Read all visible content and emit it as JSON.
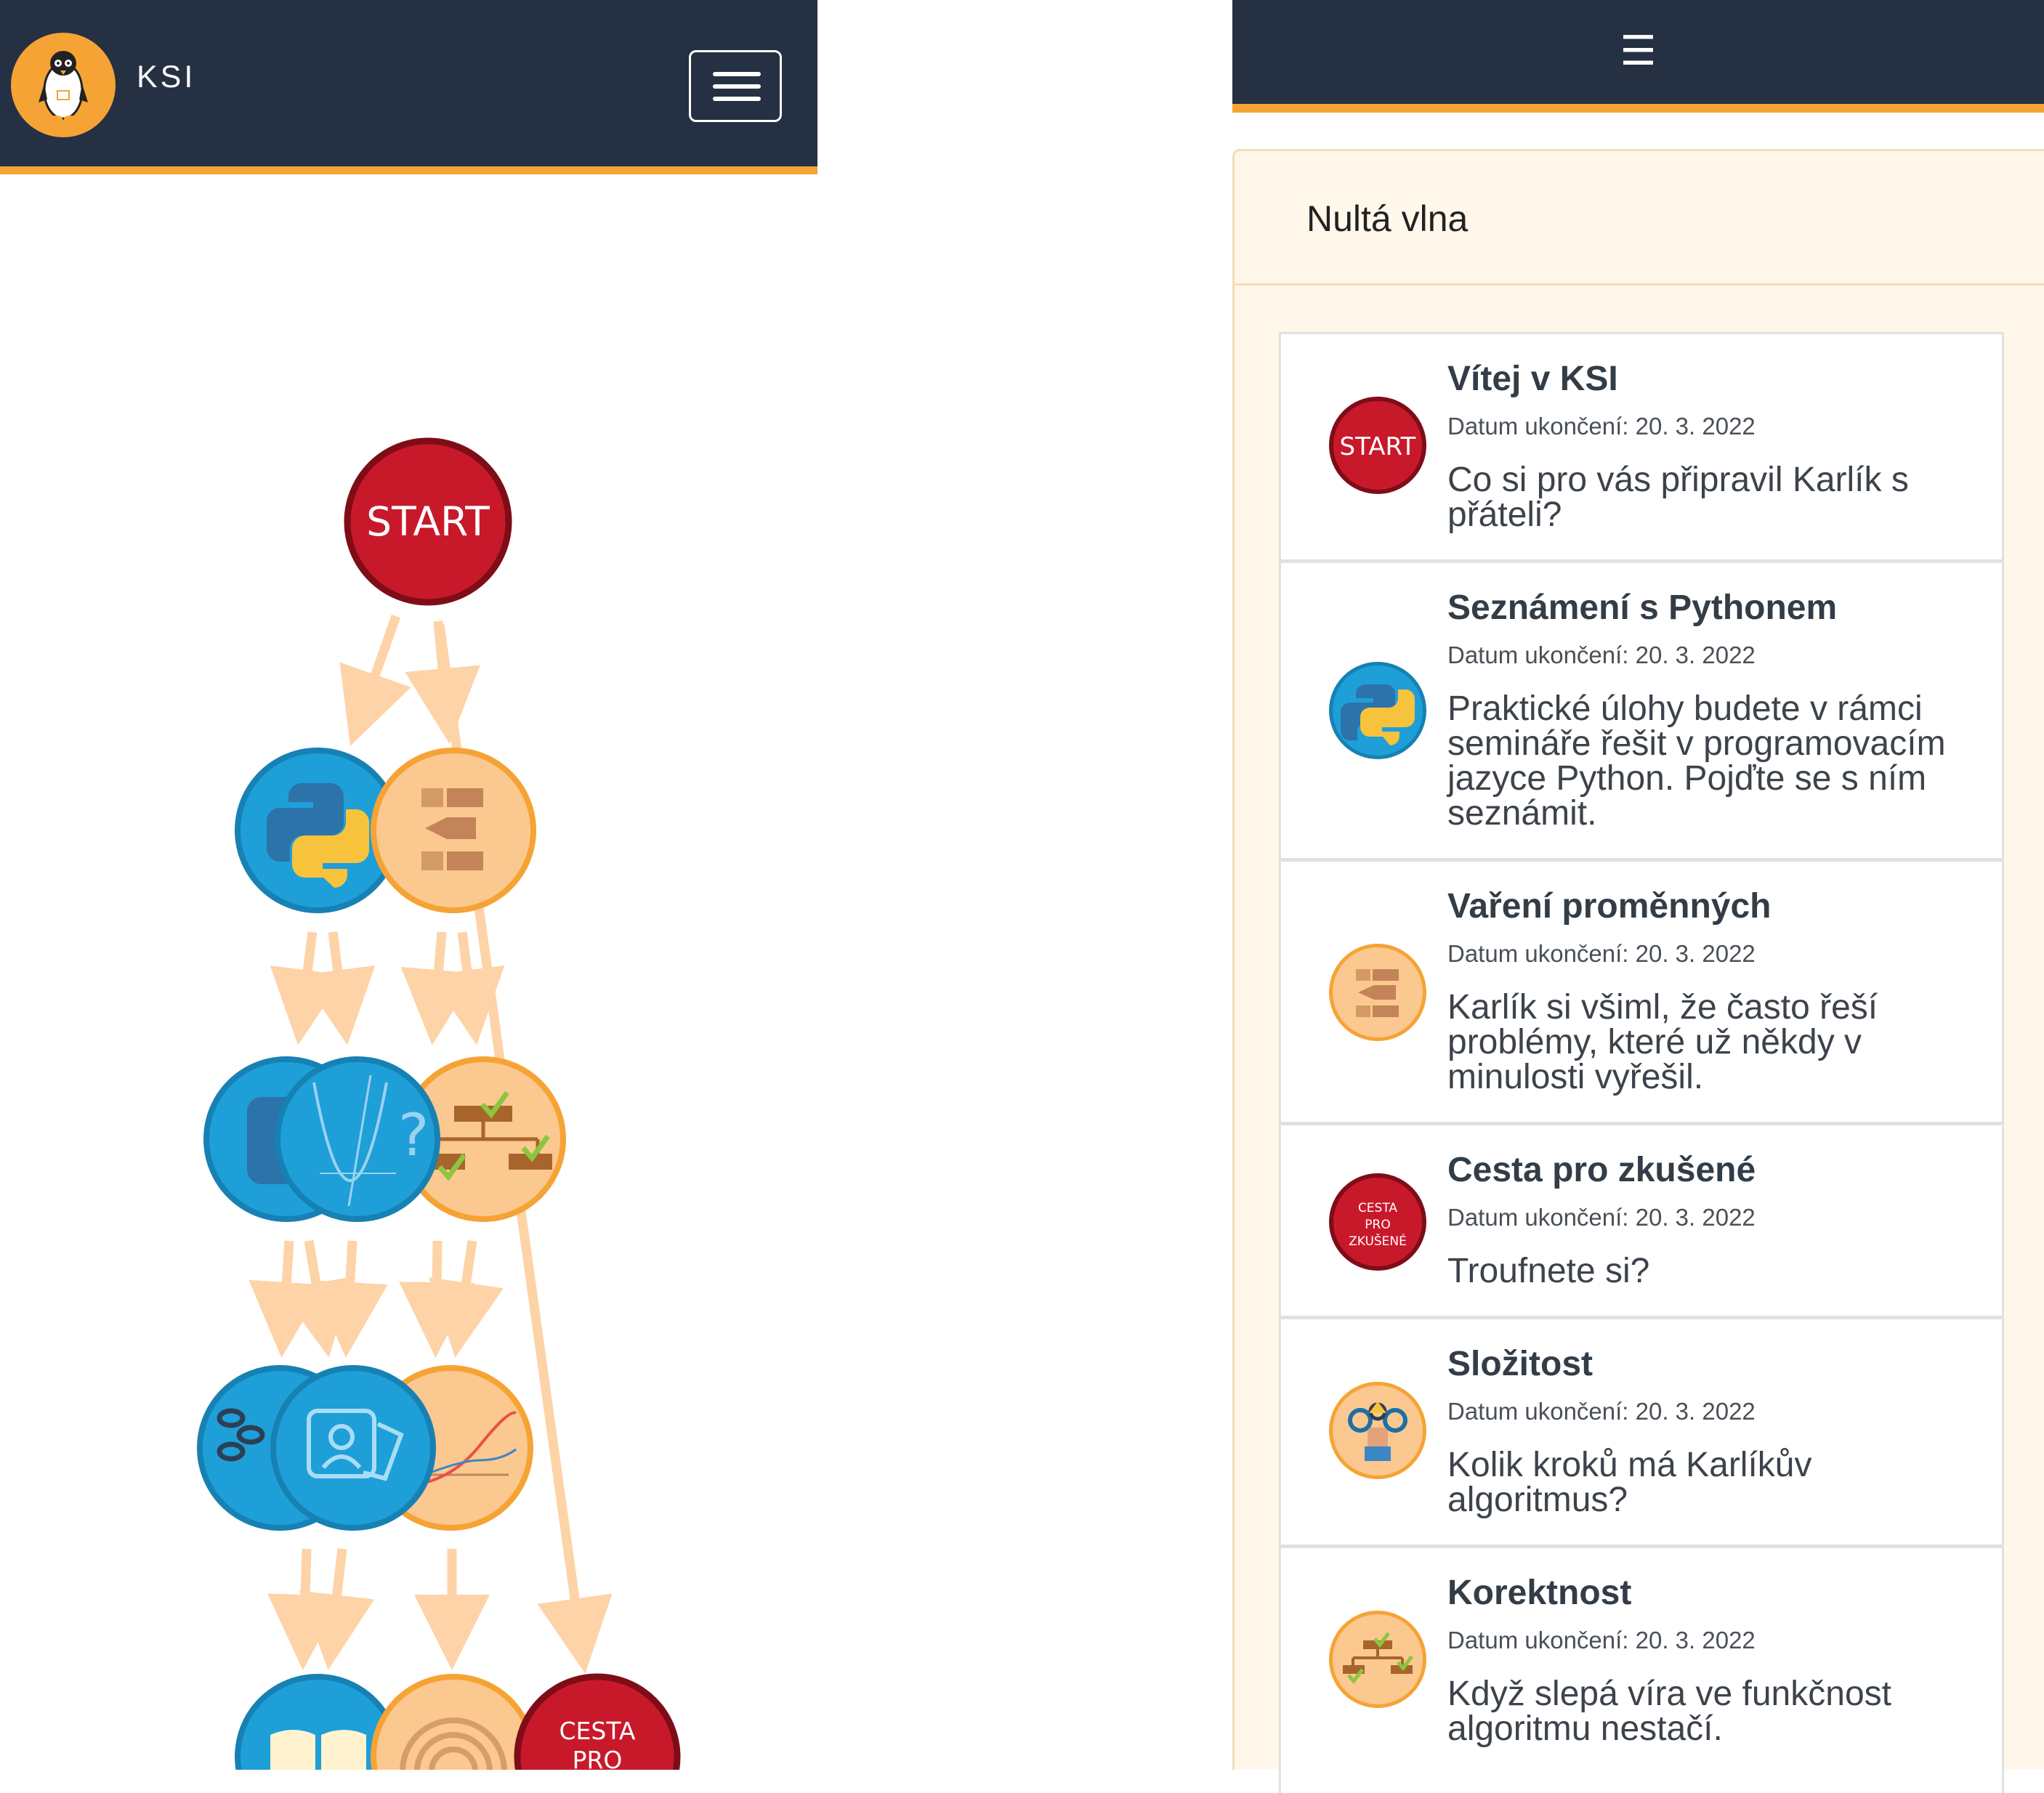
{
  "header": {
    "brand": "KSI",
    "logo_icon": "penguin-icon",
    "menu_icon": "hamburger-icon"
  },
  "right_header": {
    "menu_glyph": "☰"
  },
  "graph": {
    "start_label": "START",
    "cesta_line1": "CESTA",
    "cesta_line2": "PRO"
  },
  "wave": {
    "title": "Nultá vlna"
  },
  "tasks": [
    {
      "title": "Vítej v KSI",
      "date_label": "Datum ukončení:",
      "date": "20. 3. 2022",
      "description": "Co si pro vás připravil Karlík s přáteli?",
      "icon": "start-icon",
      "icon_label": "START"
    },
    {
      "title": "Seznámení s Pythonem",
      "date_label": "Datum ukončení:",
      "date": "20. 3. 2022",
      "description": "Praktické úlohy budete v rámci semináře řešit v programovacím jazyce Python. Pojďte se s ním seznámit.",
      "icon": "python-icon"
    },
    {
      "title": "Vaření proměnných",
      "date_label": "Datum ukončení:",
      "date": "20. 3. 2022",
      "description": "Karlík si všiml, že často řeší problémy, které už někdy v minulosti vyřešil.",
      "icon": "flowchart-icon"
    },
    {
      "title": "Cesta pro zkušené",
      "date_label": "Datum ukončení:",
      "date": "20. 3. 2022",
      "description": "Troufnete si?",
      "icon": "cesta-icon",
      "icon_label_1": "CESTA",
      "icon_label_2": "PRO",
      "icon_label_3": "ZKUŠENÉ"
    },
    {
      "title": "Složitost",
      "date_label": "Datum ukončení:",
      "date": "20. 3. 2022",
      "description": "Kolik kroků má Karlíkův algoritmus?",
      "icon": "gears-worker-icon"
    },
    {
      "title": "Korektnost",
      "date_label": "Datum ukončení:",
      "date": "20. 3. 2022",
      "description": "Když slepá víra ve funkčnost algoritmu nestačí.",
      "icon": "checked-tree-icon"
    }
  ],
  "colors": {
    "header_bg": "#253042",
    "accent_orange": "#f6a335",
    "start_red": "#c8192b",
    "python_blue": "#1e9fd8",
    "card_bg": "#fff7ea"
  }
}
